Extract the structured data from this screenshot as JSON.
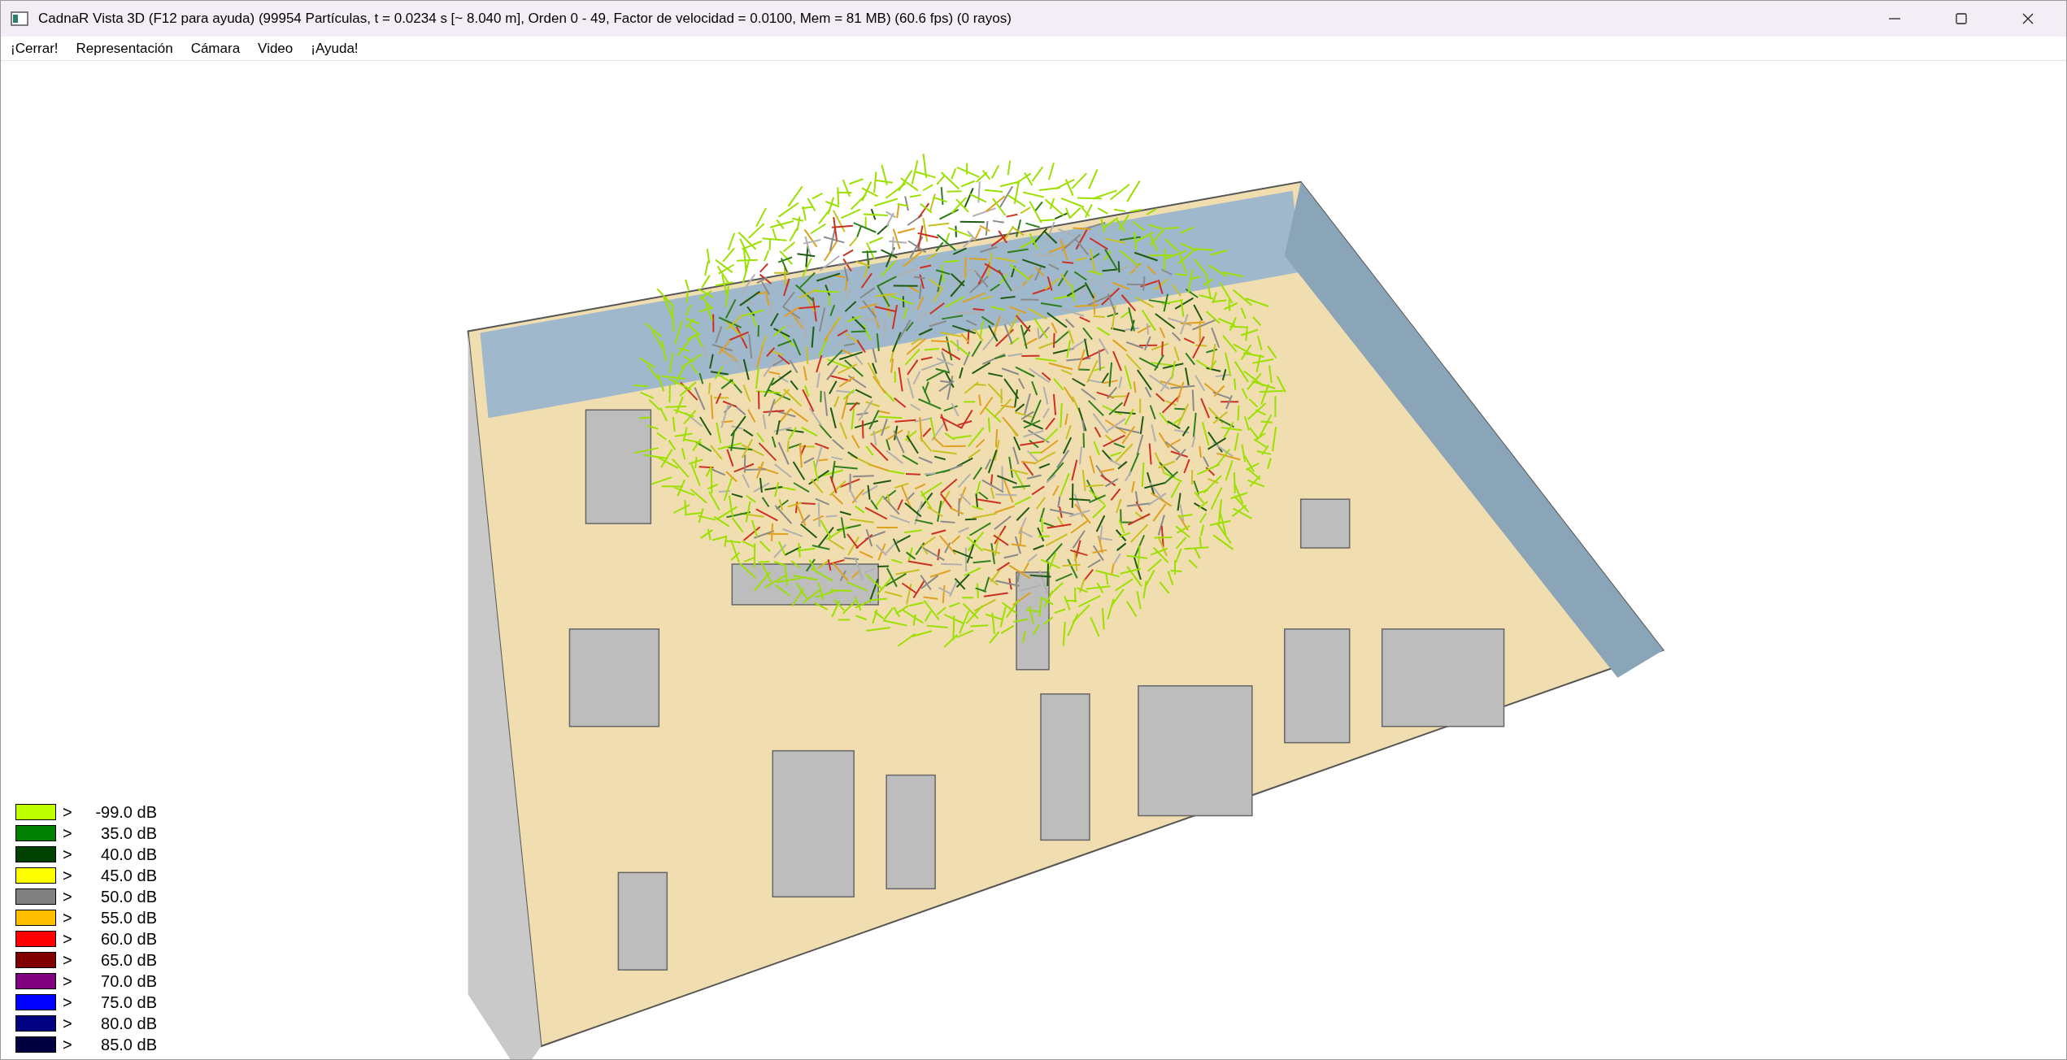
{
  "window": {
    "title": "CadnaR Vista 3D (F12 para ayuda) (99954 Partículas, t = 0.0234 s [~ 8.040 m], Orden 0 - 49, Factor de velocidad = 0.0100, Mem = 81 MB) (60.6 fps) (0 rayos)"
  },
  "menu": [
    "¡Cerrar!",
    "Representación",
    "Cámara",
    "Video",
    "¡Ayuda!"
  ],
  "legend": [
    {
      "prefix": ">",
      "label": "-99.0 dB",
      "color": "#bfff00"
    },
    {
      "prefix": ">",
      "label": "35.0 dB",
      "color": "#008000"
    },
    {
      "prefix": ">",
      "label": "40.0 dB",
      "color": "#004000"
    },
    {
      "prefix": ">",
      "label": "45.0 dB",
      "color": "#ffff00"
    },
    {
      "prefix": ">",
      "label": "50.0 dB",
      "color": "#808080"
    },
    {
      "prefix": ">",
      "label": "55.0 dB",
      "color": "#ffbf00"
    },
    {
      "prefix": ">",
      "label": "60.0 dB",
      "color": "#ff0000"
    },
    {
      "prefix": ">",
      "label": "65.0 dB",
      "color": "#800000"
    },
    {
      "prefix": ">",
      "label": "70.0 dB",
      "color": "#800080"
    },
    {
      "prefix": ">",
      "label": "75.0 dB",
      "color": "#0000ff"
    },
    {
      "prefix": ">",
      "label": "80.0 dB",
      "color": "#000080"
    },
    {
      "prefix": ">",
      "label": "85.0 dB",
      "color": "#000040"
    }
  ]
}
